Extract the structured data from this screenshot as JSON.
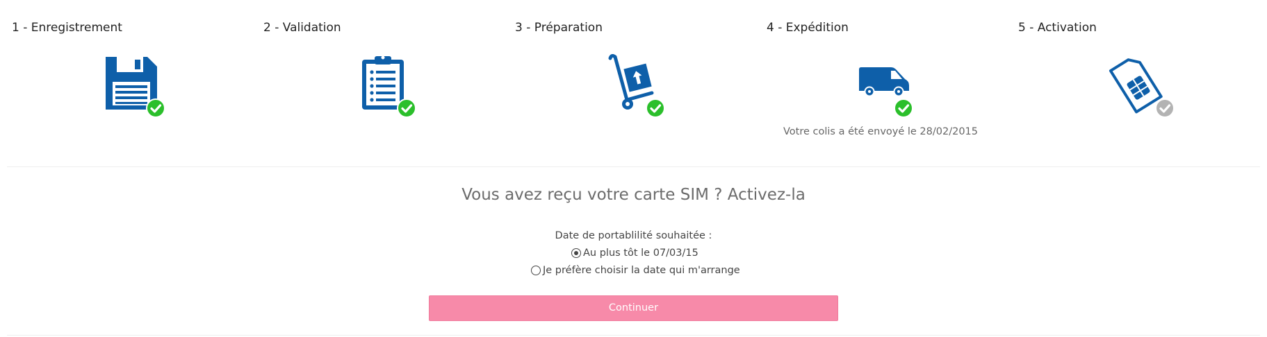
{
  "steps": [
    {
      "title": "1 - Enregistrement",
      "icon": "floppy-disk-icon",
      "status": "done"
    },
    {
      "title": "2 - Validation",
      "icon": "clipboard-list-icon",
      "status": "done"
    },
    {
      "title": "3 - Préparation",
      "icon": "hand-truck-box-icon",
      "status": "done"
    },
    {
      "title": "4 - Expédition",
      "icon": "delivery-van-icon",
      "status": "done",
      "note": "Votre colis a été envoyé le 28/02/2015"
    },
    {
      "title": "5 - Activation",
      "icon": "sim-card-icon",
      "status": "pending"
    }
  ],
  "activation": {
    "title": "Vous avez reçu votre carte SIM ? Activez-la",
    "portability_label": "Date de portablilité souhaitée :",
    "options": [
      {
        "label": "Au plus tôt le 07/03/15",
        "checked": true
      },
      {
        "label": "Je préfère choisir la date qui m'arrange",
        "checked": false
      }
    ],
    "continue_label": "Continuer"
  },
  "colors": {
    "icon_blue": "#0e5fa9",
    "check_green": "#2bbf2b",
    "check_pending": "#b3b3b3",
    "button_pink": "#f78aa9"
  }
}
